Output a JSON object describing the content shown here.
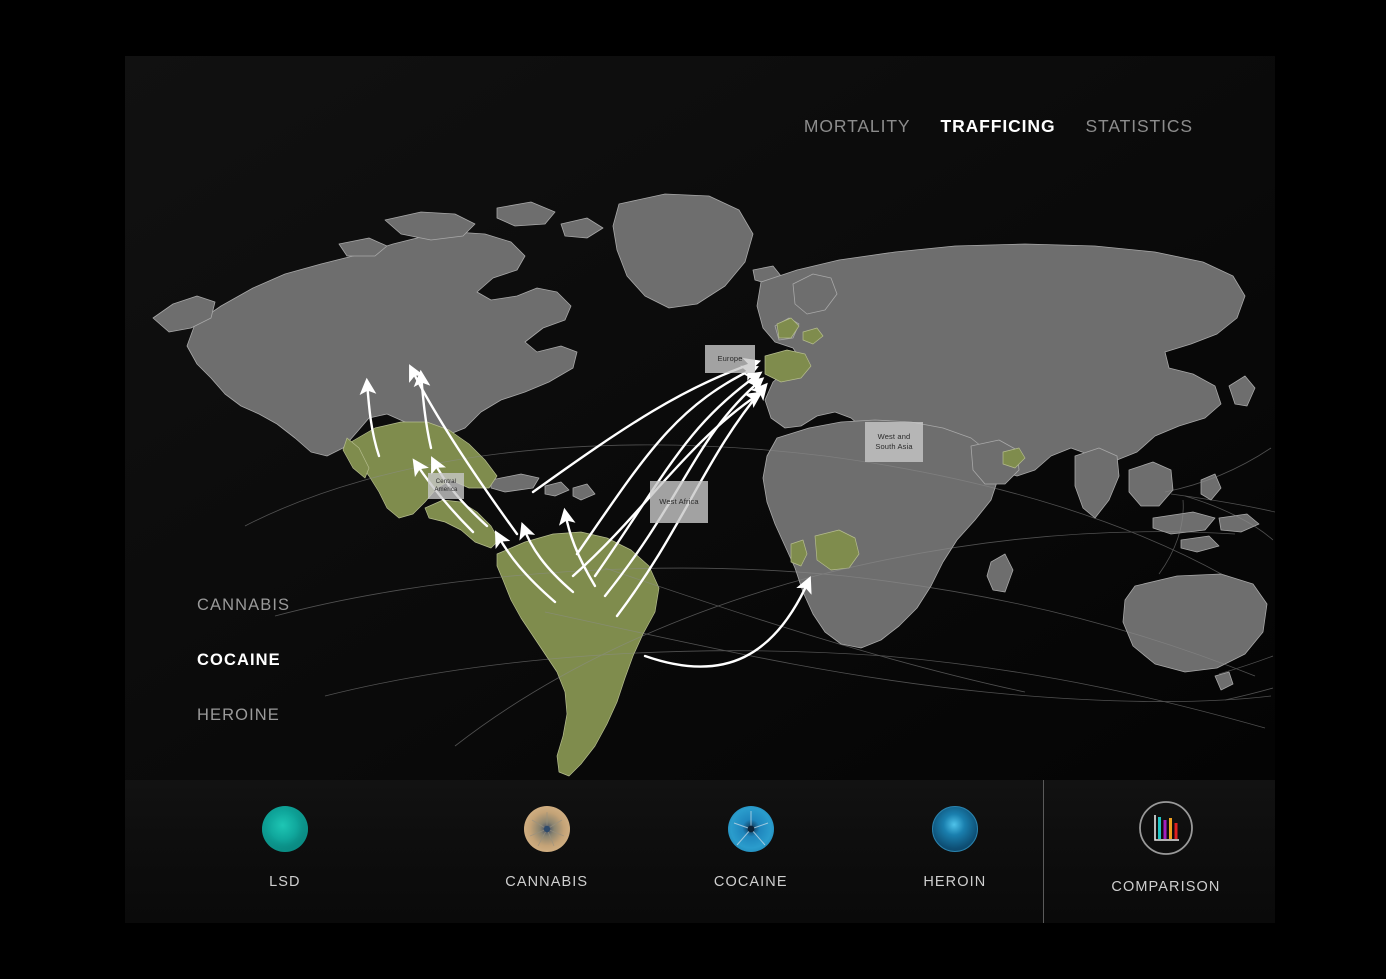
{
  "nav": {
    "items": [
      {
        "label": "MORTALITY",
        "active": false
      },
      {
        "label": "TRAFFICING",
        "active": true
      },
      {
        "label": "STATISTICS",
        "active": false
      }
    ]
  },
  "drug_selector": {
    "items": [
      {
        "label": "CANNABIS",
        "active": false
      },
      {
        "label": "COCAINE",
        "active": true
      },
      {
        "label": "HEROINE",
        "active": false
      }
    ]
  },
  "map": {
    "region_labels": [
      {
        "name": "europe",
        "text": "Europe"
      },
      {
        "name": "west-and-south-asia",
        "text": "West and\nSouth Asia"
      },
      {
        "name": "west-africa",
        "text": "West Africa"
      },
      {
        "name": "central-america",
        "text": "Central\nAmerica"
      }
    ],
    "colors": {
      "land": "#6e6e6e",
      "land_border": "#b0b0b0",
      "highlight": "#7f8c4d",
      "ocean": "#0b0b0b",
      "route_arrow": "#ffffff",
      "route_faint": "#8e8e8e"
    }
  },
  "bottom_bar": {
    "items": [
      {
        "label": "LSD",
        "icon": "lsd-molecule-orb"
      },
      {
        "label": "CANNABIS",
        "icon": "cannabis-molecule-orb"
      },
      {
        "label": "COCAINE",
        "icon": "cocaine-molecule-orb"
      },
      {
        "label": "HEROIN",
        "icon": "heroin-molecule-orb"
      },
      {
        "label": "COMPARISON",
        "icon": "bar-chart-icon"
      }
    ],
    "comparison_bar_colors": [
      "#21c4c4",
      "#a020c0",
      "#f0a020",
      "#e02020"
    ]
  }
}
